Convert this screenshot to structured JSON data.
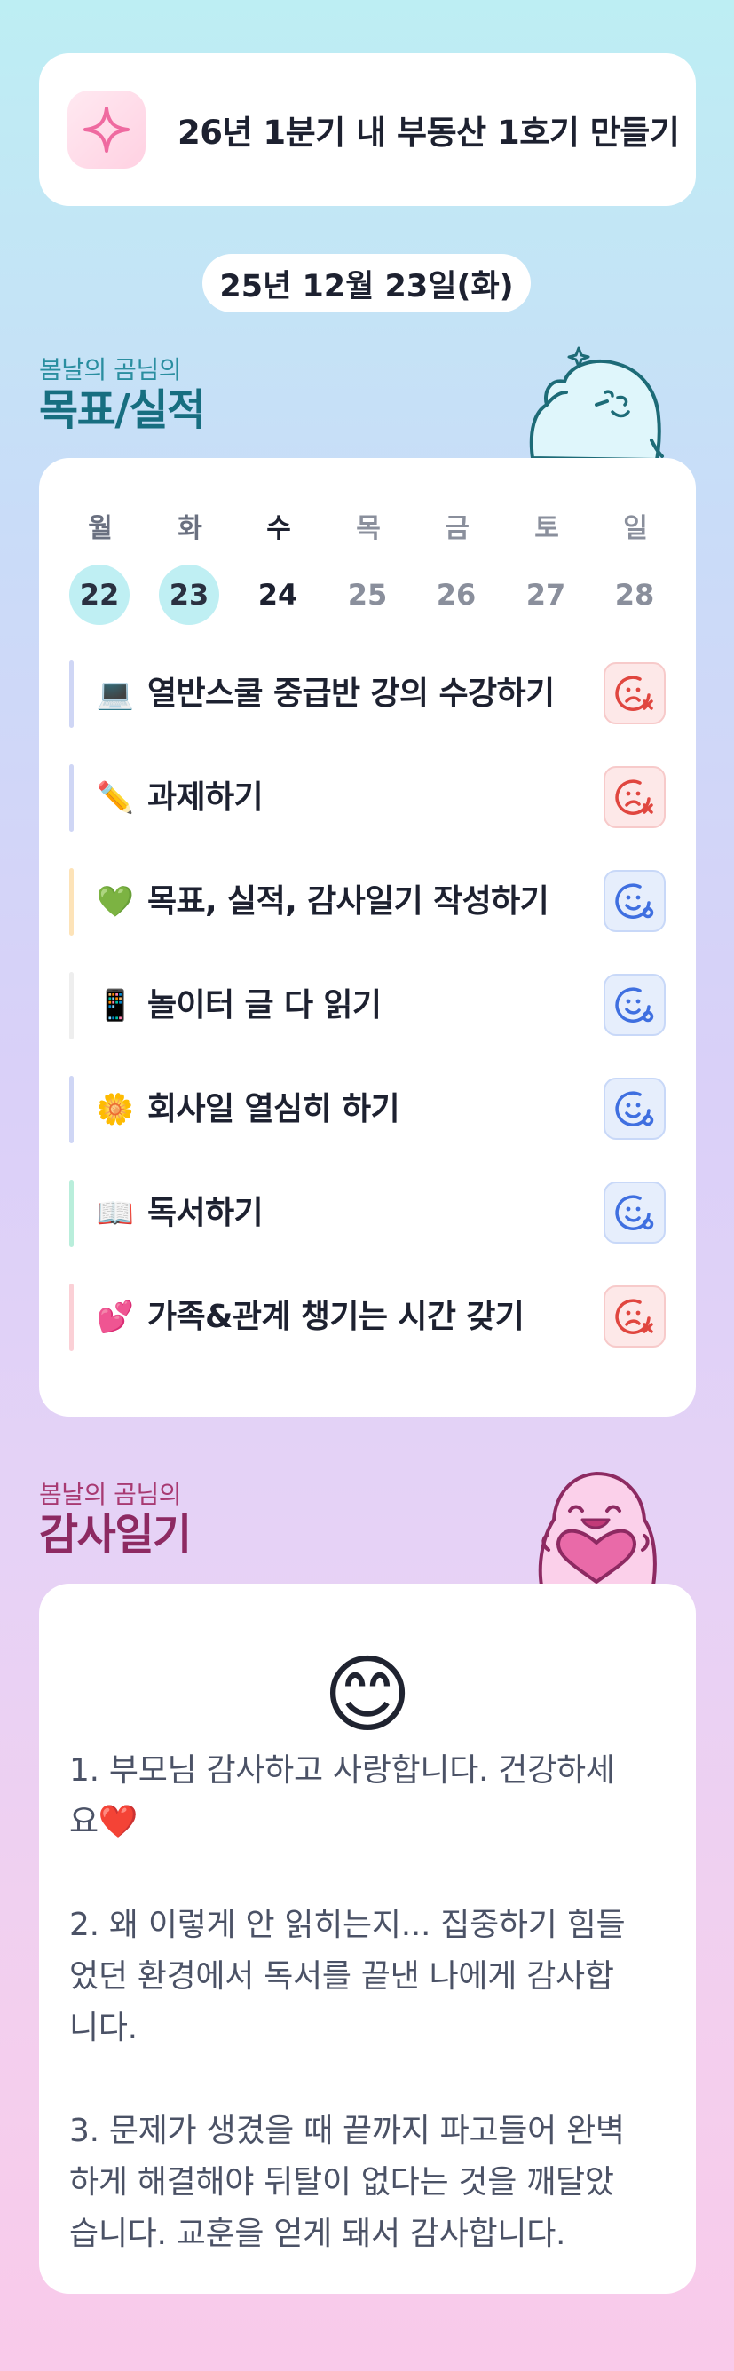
{
  "goal": {
    "icon": "sparkle-icon",
    "text": "26년 1분기 내 부동산 1호기 만들기"
  },
  "date": "25년 12월 23일(화)",
  "goals_section": {
    "subtitle": "봄날의 곰님의",
    "title": "목표/실적",
    "subtitle_color": "#2a8ea0",
    "title_color": "#176e80"
  },
  "week": [
    {
      "name": "월",
      "num": "22",
      "state": "done"
    },
    {
      "name": "화",
      "num": "23",
      "state": "done"
    },
    {
      "name": "수",
      "num": "24",
      "state": "today"
    },
    {
      "name": "목",
      "num": "25",
      "state": "future"
    },
    {
      "name": "금",
      "num": "26",
      "state": "future"
    },
    {
      "name": "토",
      "num": "27",
      "state": "future"
    },
    {
      "name": "일",
      "num": "28",
      "state": "future"
    }
  ],
  "tasks": [
    {
      "emoji": "💻",
      "label": "열반스쿨 중급반 강의 수강하기",
      "bar_color": "#cfd6f5",
      "status": "sad"
    },
    {
      "emoji": "✏️",
      "label": "과제하기",
      "bar_color": "#cfd6f5",
      "status": "sad"
    },
    {
      "emoji": "💚",
      "label": "목표, 실적, 감사일기 작성하기",
      "bar_color": "#fde3b8",
      "status": "happy"
    },
    {
      "emoji": "📱",
      "label": "놀이터 글 다 읽기",
      "bar_color": "#eeeeee",
      "status": "happy"
    },
    {
      "emoji": "🌼",
      "label": "회사일 열심히 하기",
      "bar_color": "#cfd6f5",
      "status": "happy"
    },
    {
      "emoji": "📖",
      "label": "독서하기",
      "bar_color": "#b9eedb",
      "status": "happy"
    },
    {
      "emoji": "💕",
      "label": "가족&관계 챙기는 시간 갖기",
      "bar_color": "#fbd0d6",
      "status": "sad"
    }
  ],
  "gratitude_section": {
    "subtitle": "봄날의 곰님의",
    "title": "감사일기",
    "subtitle_color": "#a83a72",
    "title_color": "#8d2a62"
  },
  "gratitude": {
    "emoji": "😊",
    "text": "1. 부모님 감사하고 사랑합니다. 건강하세\n요❤️\n\n2. 왜 이렇게 안 읽히는지... 집중하기 힘들\n었던 환경에서 독서를 끝낸 나에게 감사합\n니다.\n\n3. 문제가 생겼을 때 끝까지 파고들어 완벽\n하게 해결해야 뒤탈이 없다는 것을 깨달았\n습니다. 교훈을 얻게 돼서 감사합니다."
  },
  "colors": {
    "sad": "#e0463f",
    "happy": "#3f6fe0",
    "done_circle": "#bfeff3",
    "future_day": "#8a8f9c",
    "past_day": "#6a7080"
  }
}
